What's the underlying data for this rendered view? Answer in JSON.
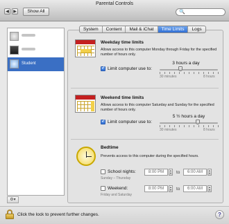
{
  "window": {
    "title": "Parental Controls"
  },
  "toolbar": {
    "back_icon": "◀",
    "forward_icon": "▶",
    "show_all_label": "Show All",
    "search_placeholder": "",
    "search_icon": "🔍"
  },
  "sidebar": {
    "users": [
      {
        "name": "",
        "avatar": "flower",
        "selected": false
      },
      {
        "name": "",
        "avatar": "photo",
        "selected": false
      },
      {
        "name": "Student",
        "avatar": "snowflake",
        "selected": true
      }
    ],
    "gear_icon": "⚙▾"
  },
  "tabs": [
    {
      "label": "System",
      "active": false
    },
    {
      "label": "Content",
      "active": false
    },
    {
      "label": "Mail & iChat",
      "active": false
    },
    {
      "label": "Time Limits",
      "active": true
    },
    {
      "label": "Logs",
      "active": false
    }
  ],
  "weekday": {
    "title": "Weekday time limits",
    "description": "Allows access to this computer Monday through Friday for the specified number of hours only.",
    "checkbox_label": "Limit computer use to:",
    "checked": true,
    "value_label": "3 hours a day",
    "min_label": "30 minutes",
    "max_label": "8 hours",
    "level_fraction": 0.36
  },
  "weekend": {
    "title": "Weekend time limits",
    "description": "Allows access to this computer Saturday and Sunday for the specified number of hours only.",
    "checkbox_label": "Limit computer use to:",
    "checked": true,
    "value_label": "5 ½ hours a day",
    "min_label": "30 minutes",
    "max_label": "8 hours",
    "level_fraction": 0.66
  },
  "bedtime": {
    "title": "Bedtime",
    "description": "Prevents access to this computer during the specified hours.",
    "school_label": "School nights:",
    "school_sub": "Sunday – Thursday",
    "school_from": "8:00 PM",
    "school_to": "6:00 AM",
    "weekend_label": "Weekend:",
    "weekend_sub": "Friday and Saturday",
    "weekend_from": "8:00 PM",
    "weekend_to": "6:00 AM",
    "to_label": "to"
  },
  "footer": {
    "lock_text": "Click the lock to prevent further changes.",
    "help_label": "?"
  },
  "colors": {
    "accent": "#3a6fc4",
    "calendar_red": "#c42020",
    "clock_yellow": "#f3d650"
  }
}
